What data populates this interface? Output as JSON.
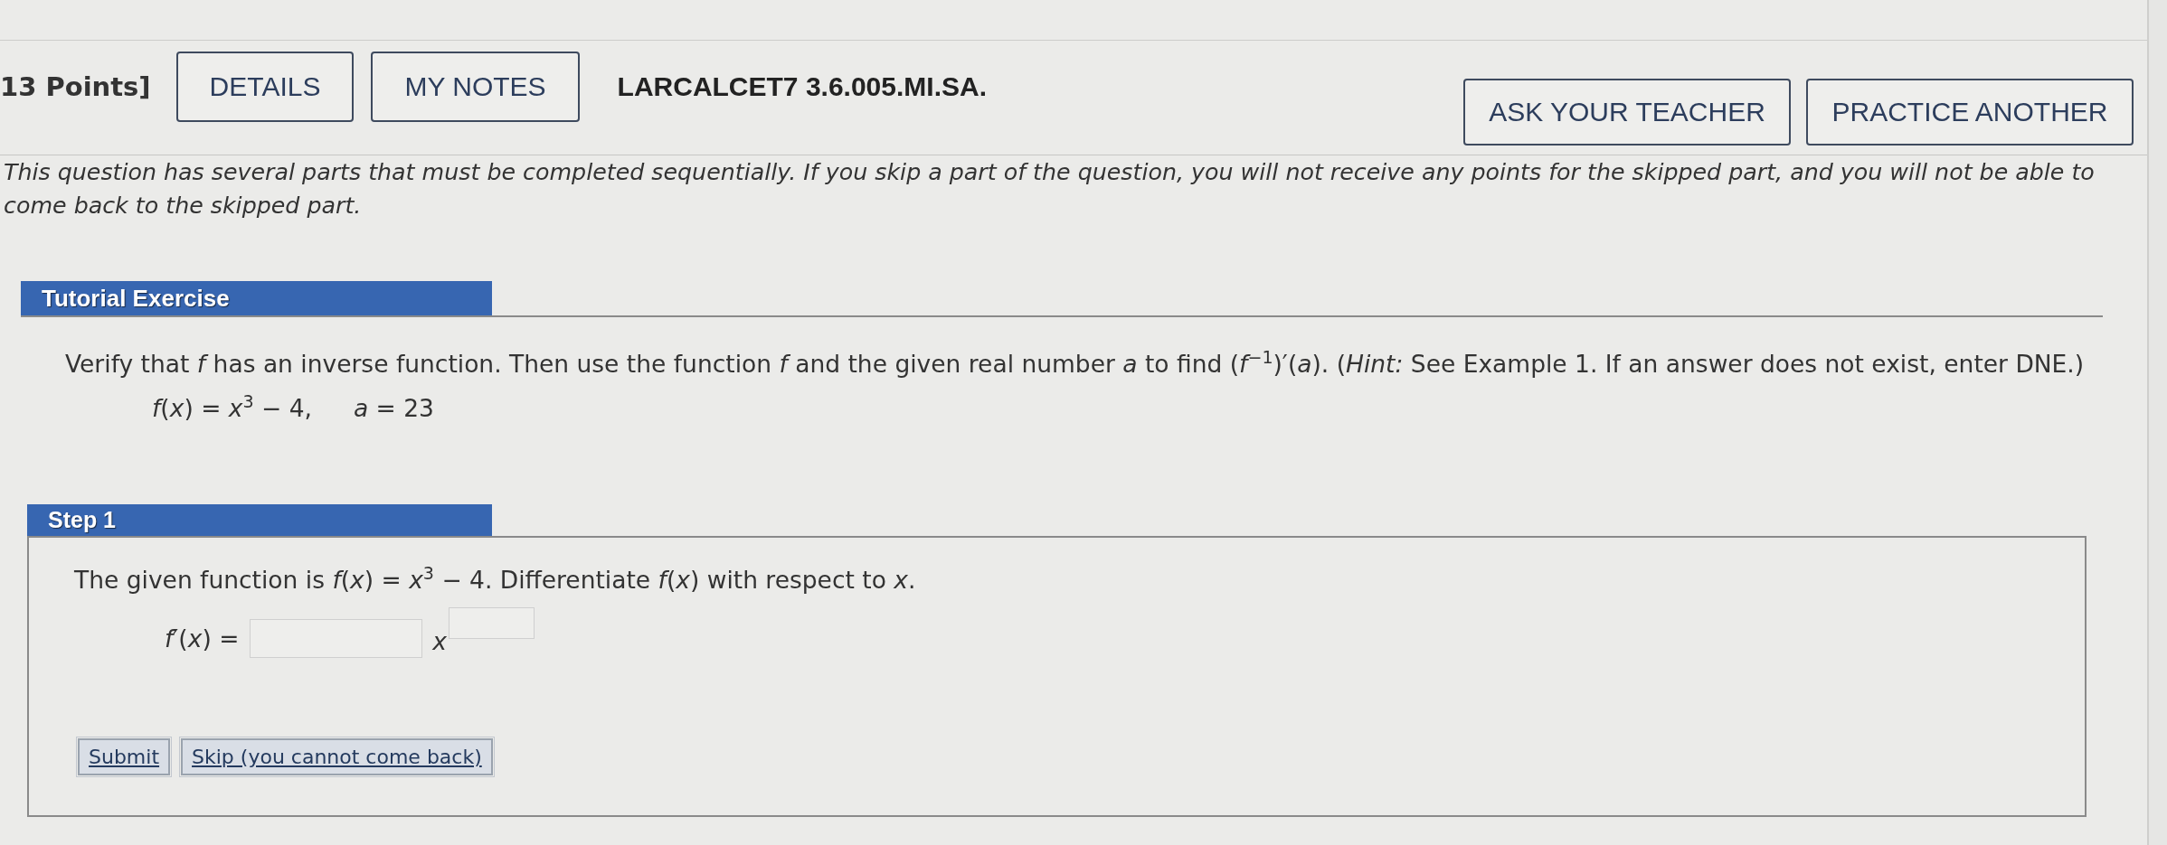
{
  "header": {
    "points": "13 Points]",
    "buttons": [
      {
        "label": "DETAILS"
      },
      {
        "label": "MY NOTES"
      }
    ],
    "question_id": "LARCALCET7 3.6.005.MI.SA.",
    "actions": [
      {
        "label": "ASK YOUR TEACHER"
      },
      {
        "label": "PRACTICE ANOTHER"
      }
    ]
  },
  "instructions": "This question has several parts that must be completed sequentially. If you skip a part of the question, you will not receive any points for the skipped part, and you will not be able to come back to the skipped part.",
  "tutorial": {
    "title": "Tutorial Exercise",
    "prompt": "Verify that *f* has an inverse function. Then use the function *f* and the given real number *a* to find (*f*$^{−1}$)′(*a*). (*Hint:* See Example 1. If an answer does not exist, enter DNE.)",
    "given": [
      "*f*(*x*) = *x*$^{3}$ − 4,",
      "*a* = 23"
    ]
  },
  "step": {
    "title": "Step 1",
    "text": "The given function is *f*(*x*) = *x*$^{3}$ − 4. Differentiate *f*(*x*) with respect to *x*.",
    "answer": {
      "label": "*f*′(*x*) =",
      "parts": [
        {
          "kind": "field"
        },
        {
          "kind": "variable",
          "text": "x"
        },
        {
          "kind": "exponent_field"
        }
      ]
    },
    "buttons": [
      {
        "label": "Submit"
      },
      {
        "label": "Skip (you cannot come back)"
      }
    ]
  }
}
